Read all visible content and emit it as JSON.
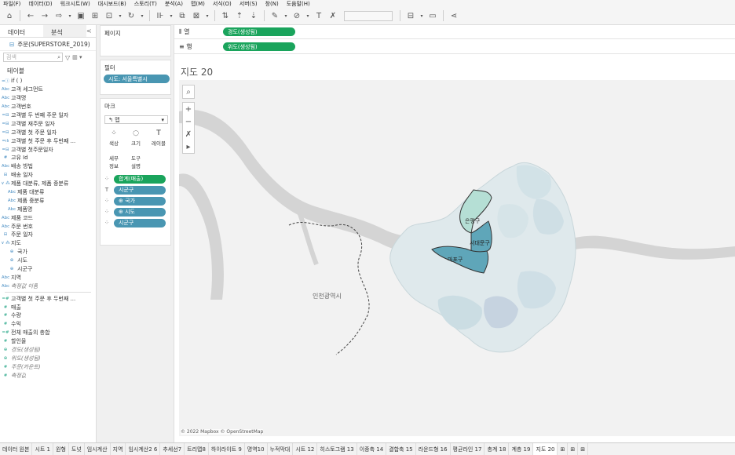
{
  "menu": [
    "파일(F)",
    "데이터(D)",
    "워크시트(W)",
    "대시보드(B)",
    "스토리(T)",
    "분석(A)",
    "맵(M)",
    "서식(O)",
    "서버(S)",
    "창(N)",
    "도움말(H)"
  ],
  "left_panel": {
    "tab_data": "데이터",
    "tab_analysis": "분석",
    "collapse": "<",
    "source_name": "주문(SUPERSTORE_2019)",
    "search_placeholder": "검색",
    "section_table": "테이블",
    "fields": [
      {
        "icon": "=ⓘ",
        "label": "if ( )",
        "kind": "dim"
      },
      {
        "icon": "Abc",
        "label": "고객 세그먼트",
        "kind": "dim"
      },
      {
        "icon": "Abc",
        "label": "고객명",
        "kind": "dim"
      },
      {
        "icon": "Abc",
        "label": "고객번호",
        "kind": "dim"
      },
      {
        "icon": "=⊟",
        "label": "고객별 두 번째 주문 일자",
        "kind": "dim"
      },
      {
        "icon": "=⊟",
        "label": "고객별 재주문 일자",
        "kind": "dim"
      },
      {
        "icon": "=⊟",
        "label": "고객별 첫 주문 일자",
        "kind": "dim"
      },
      {
        "icon": "=ılı",
        "label": "고객별 첫 주문 후 두번째 ...",
        "kind": "dim"
      },
      {
        "icon": "=⊟",
        "label": "고객별 첫주문일자",
        "kind": "dim"
      },
      {
        "icon": "#",
        "label": "고유 Id",
        "kind": "dim"
      },
      {
        "icon": "Abc",
        "label": "배송 방법",
        "kind": "dim"
      },
      {
        "icon": "⊟",
        "label": "배송 일자",
        "kind": "dim"
      },
      {
        "icon": "∨ ⁂",
        "label": "제품 대분류, 제품 중분류",
        "kind": "dim"
      },
      {
        "icon": "Abc",
        "label": "제품 대분류",
        "kind": "dim",
        "indent": true
      },
      {
        "icon": "Abc",
        "label": "제품 중분류",
        "kind": "dim",
        "indent": true
      },
      {
        "icon": "Abc",
        "label": "제품명",
        "kind": "dim",
        "indent": true
      },
      {
        "icon": "Abc",
        "label": "제품 코드",
        "kind": "dim"
      },
      {
        "icon": "Abc",
        "label": "주문 번호",
        "kind": "dim"
      },
      {
        "icon": "⊟",
        "label": "주문 일자",
        "kind": "dim"
      },
      {
        "icon": "∨ ⁂",
        "label": "지도",
        "kind": "dim"
      },
      {
        "icon": "⊕",
        "label": "국가",
        "kind": "dim",
        "indent": true
      },
      {
        "icon": "⊕",
        "label": "시도",
        "kind": "dim",
        "indent": true
      },
      {
        "icon": "⊕",
        "label": "시군구",
        "kind": "dim",
        "indent": true
      },
      {
        "icon": "Abc",
        "label": "지역",
        "kind": "dim"
      },
      {
        "icon": "Abc",
        "label": "측정값 이름",
        "kind": "dim",
        "italic": true
      },
      {
        "divider": true
      },
      {
        "icon": "=#",
        "label": "고객별 첫 주문 후 두번째 ...",
        "kind": "mea"
      },
      {
        "icon": "#",
        "label": "매출",
        "kind": "mea"
      },
      {
        "icon": "#",
        "label": "수량",
        "kind": "mea"
      },
      {
        "icon": "#",
        "label": "수익",
        "kind": "mea"
      },
      {
        "icon": "=#",
        "label": "전체 매출의 총합",
        "kind": "mea"
      },
      {
        "icon": "#",
        "label": "할인율",
        "kind": "mea"
      },
      {
        "icon": "⊕",
        "label": "경도(생성됨)",
        "kind": "mea",
        "italic": true
      },
      {
        "icon": "⊕",
        "label": "위도(생성됨)",
        "kind": "mea",
        "italic": true
      },
      {
        "icon": "#",
        "label": "주문(카운트)",
        "kind": "mea",
        "italic": true
      },
      {
        "icon": "#",
        "label": "측정값",
        "kind": "mea",
        "italic": true
      }
    ]
  },
  "cards": {
    "pages": "페이지",
    "filters": "필터",
    "filter_pill": "시도: 서울특별시",
    "marks": "마크",
    "mark_type": "맵",
    "mark_type_icon": "↰",
    "buttons": [
      {
        "label": "색상",
        "glyph": "⁘"
      },
      {
        "label": "크기",
        "glyph": "◌"
      },
      {
        "label": "레이블",
        "glyph": "T"
      },
      {
        "label": "세부\n정보",
        "glyph": ""
      },
      {
        "label": "도구\n설명",
        "glyph": ""
      }
    ],
    "mark_pills": [
      {
        "icon": "⁘",
        "label": "합계(매출)",
        "color": "green"
      },
      {
        "icon": "T",
        "label": "시군구",
        "color": "blue"
      },
      {
        "icon": "⁘",
        "label": "⊕ 국가",
        "color": "blue"
      },
      {
        "icon": "⁘",
        "label": "⊕ 시도",
        "color": "blue"
      },
      {
        "icon": "⁘",
        "label": "시군구",
        "color": "blue"
      }
    ]
  },
  "shelves": {
    "columns_label": "열",
    "columns_pill": "경도(생성됨)",
    "rows_label": "행",
    "rows_pill": "위도(생성됨)"
  },
  "viz": {
    "title": "지도 20",
    "map_labels": {
      "incheon": "인천광역시",
      "eunpyeong": "은평구",
      "seodaemun": "서대문구",
      "mapo": "마포구"
    },
    "attribution": "© 2022 Mapbox © OpenStreetMap"
  },
  "sheets": [
    "데이터 원본",
    "시트 1",
    "원형",
    "도넛",
    "임시계산",
    "지역",
    "임시계산2 6",
    "추세선7",
    "트리맵8",
    "하이라이트 9",
    "명역10",
    "누적막대",
    "시트 12",
    "히스토그램 13",
    "이중축 14",
    "결합축 15",
    "라운드형 16",
    "평균라인 17",
    "총계 18",
    "계층 19",
    "지도 20"
  ],
  "active_sheet": "지도 20",
  "colors": {
    "accent_green": "#1aa45c",
    "pill_blue": "#4996b2",
    "highlight_dark": "#5fa6b9",
    "highlight_light": "#b5dfd5"
  }
}
